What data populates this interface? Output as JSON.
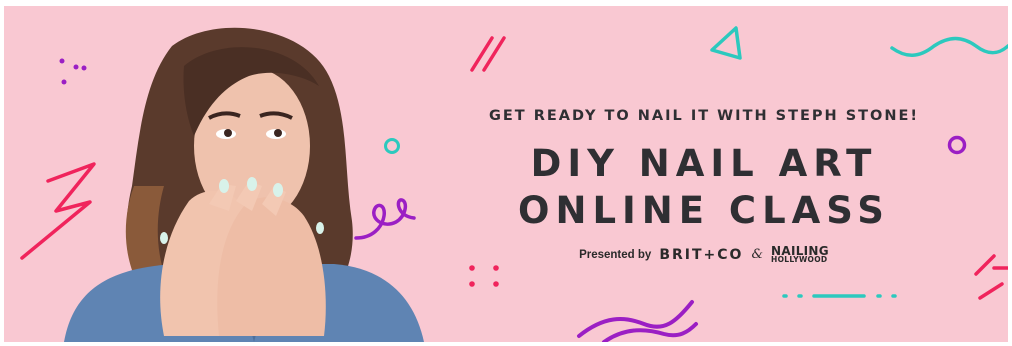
{
  "banner": {
    "tagline": "GET READY TO NAIL IT WITH STEPH STONE!",
    "title_line1": "DIY NAIL ART",
    "title_line2": "ONLINE CLASS",
    "presented_by": "Presented by",
    "partner1": "BRIT+CO",
    "ampersand": "&",
    "partner2_line1": "NAILING",
    "partner2_line2": "HOLLYWOOD"
  },
  "colors": {
    "background": "#f9c8d2",
    "text": "#2f2f33",
    "accent_pink": "#f0245c",
    "accent_teal": "#2cc9be",
    "accent_purple": "#9b1fc4"
  },
  "decorations": [
    "pink-double-slash",
    "teal-triangle",
    "teal-wave",
    "purple-dots",
    "teal-ring",
    "purple-ring",
    "pink-zigzag",
    "purple-squiggle",
    "pink-dots",
    "teal-dashes",
    "pink-lines",
    "purple-waves"
  ]
}
